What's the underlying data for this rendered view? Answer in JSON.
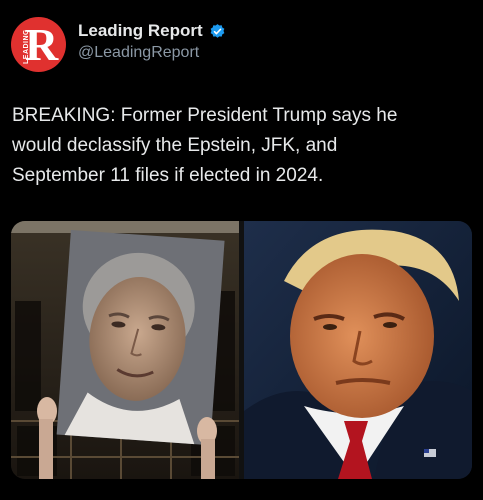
{
  "author": {
    "avatar_text": "R",
    "avatar_small_text": "LEADING",
    "display_name": "Leading Report",
    "handle": "@LeadingReport",
    "verified": true
  },
  "tweet": {
    "lines": [
      "BREAKING: Former President Trump says he",
      "would declassify the Epstein, JFK, and",
      "September 11 files if elected in 2024."
    ]
  },
  "media": {
    "count": 2
  },
  "colors": {
    "avatar_bg": "#e0312f",
    "verified": "#1d9bf0",
    "background": "#000000",
    "text": "#e7e9ea",
    "secondary": "#8b98a5"
  }
}
